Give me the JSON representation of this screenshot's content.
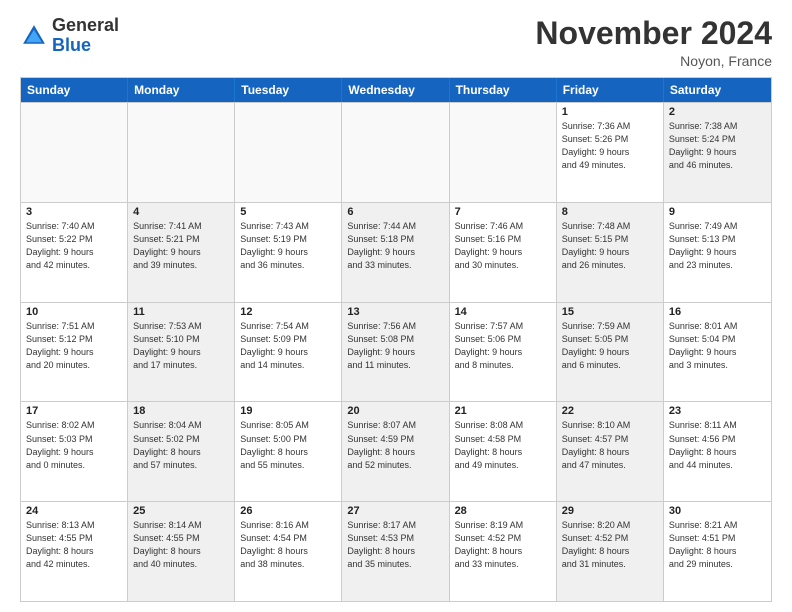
{
  "header": {
    "logo_general": "General",
    "logo_blue": "Blue",
    "month_title": "November 2024",
    "location": "Noyon, France"
  },
  "days_of_week": [
    "Sunday",
    "Monday",
    "Tuesday",
    "Wednesday",
    "Thursday",
    "Friday",
    "Saturday"
  ],
  "weeks": [
    [
      {
        "day": "",
        "info": "",
        "shaded": false,
        "empty": true
      },
      {
        "day": "",
        "info": "",
        "shaded": false,
        "empty": true
      },
      {
        "day": "",
        "info": "",
        "shaded": false,
        "empty": true
      },
      {
        "day": "",
        "info": "",
        "shaded": false,
        "empty": true
      },
      {
        "day": "",
        "info": "",
        "shaded": false,
        "empty": true
      },
      {
        "day": "1",
        "info": "Sunrise: 7:36 AM\nSunset: 5:26 PM\nDaylight: 9 hours\nand 49 minutes.",
        "shaded": false,
        "empty": false
      },
      {
        "day": "2",
        "info": "Sunrise: 7:38 AM\nSunset: 5:24 PM\nDaylight: 9 hours\nand 46 minutes.",
        "shaded": true,
        "empty": false
      }
    ],
    [
      {
        "day": "3",
        "info": "Sunrise: 7:40 AM\nSunset: 5:22 PM\nDaylight: 9 hours\nand 42 minutes.",
        "shaded": false,
        "empty": false
      },
      {
        "day": "4",
        "info": "Sunrise: 7:41 AM\nSunset: 5:21 PM\nDaylight: 9 hours\nand 39 minutes.",
        "shaded": true,
        "empty": false
      },
      {
        "day": "5",
        "info": "Sunrise: 7:43 AM\nSunset: 5:19 PM\nDaylight: 9 hours\nand 36 minutes.",
        "shaded": false,
        "empty": false
      },
      {
        "day": "6",
        "info": "Sunrise: 7:44 AM\nSunset: 5:18 PM\nDaylight: 9 hours\nand 33 minutes.",
        "shaded": true,
        "empty": false
      },
      {
        "day": "7",
        "info": "Sunrise: 7:46 AM\nSunset: 5:16 PM\nDaylight: 9 hours\nand 30 minutes.",
        "shaded": false,
        "empty": false
      },
      {
        "day": "8",
        "info": "Sunrise: 7:48 AM\nSunset: 5:15 PM\nDaylight: 9 hours\nand 26 minutes.",
        "shaded": true,
        "empty": false
      },
      {
        "day": "9",
        "info": "Sunrise: 7:49 AM\nSunset: 5:13 PM\nDaylight: 9 hours\nand 23 minutes.",
        "shaded": false,
        "empty": false
      }
    ],
    [
      {
        "day": "10",
        "info": "Sunrise: 7:51 AM\nSunset: 5:12 PM\nDaylight: 9 hours\nand 20 minutes.",
        "shaded": false,
        "empty": false
      },
      {
        "day": "11",
        "info": "Sunrise: 7:53 AM\nSunset: 5:10 PM\nDaylight: 9 hours\nand 17 minutes.",
        "shaded": true,
        "empty": false
      },
      {
        "day": "12",
        "info": "Sunrise: 7:54 AM\nSunset: 5:09 PM\nDaylight: 9 hours\nand 14 minutes.",
        "shaded": false,
        "empty": false
      },
      {
        "day": "13",
        "info": "Sunrise: 7:56 AM\nSunset: 5:08 PM\nDaylight: 9 hours\nand 11 minutes.",
        "shaded": true,
        "empty": false
      },
      {
        "day": "14",
        "info": "Sunrise: 7:57 AM\nSunset: 5:06 PM\nDaylight: 9 hours\nand 8 minutes.",
        "shaded": false,
        "empty": false
      },
      {
        "day": "15",
        "info": "Sunrise: 7:59 AM\nSunset: 5:05 PM\nDaylight: 9 hours\nand 6 minutes.",
        "shaded": true,
        "empty": false
      },
      {
        "day": "16",
        "info": "Sunrise: 8:01 AM\nSunset: 5:04 PM\nDaylight: 9 hours\nand 3 minutes.",
        "shaded": false,
        "empty": false
      }
    ],
    [
      {
        "day": "17",
        "info": "Sunrise: 8:02 AM\nSunset: 5:03 PM\nDaylight: 9 hours\nand 0 minutes.",
        "shaded": false,
        "empty": false
      },
      {
        "day": "18",
        "info": "Sunrise: 8:04 AM\nSunset: 5:02 PM\nDaylight: 8 hours\nand 57 minutes.",
        "shaded": true,
        "empty": false
      },
      {
        "day": "19",
        "info": "Sunrise: 8:05 AM\nSunset: 5:00 PM\nDaylight: 8 hours\nand 55 minutes.",
        "shaded": false,
        "empty": false
      },
      {
        "day": "20",
        "info": "Sunrise: 8:07 AM\nSunset: 4:59 PM\nDaylight: 8 hours\nand 52 minutes.",
        "shaded": true,
        "empty": false
      },
      {
        "day": "21",
        "info": "Sunrise: 8:08 AM\nSunset: 4:58 PM\nDaylight: 8 hours\nand 49 minutes.",
        "shaded": false,
        "empty": false
      },
      {
        "day": "22",
        "info": "Sunrise: 8:10 AM\nSunset: 4:57 PM\nDaylight: 8 hours\nand 47 minutes.",
        "shaded": true,
        "empty": false
      },
      {
        "day": "23",
        "info": "Sunrise: 8:11 AM\nSunset: 4:56 PM\nDaylight: 8 hours\nand 44 minutes.",
        "shaded": false,
        "empty": false
      }
    ],
    [
      {
        "day": "24",
        "info": "Sunrise: 8:13 AM\nSunset: 4:55 PM\nDaylight: 8 hours\nand 42 minutes.",
        "shaded": false,
        "empty": false
      },
      {
        "day": "25",
        "info": "Sunrise: 8:14 AM\nSunset: 4:55 PM\nDaylight: 8 hours\nand 40 minutes.",
        "shaded": true,
        "empty": false
      },
      {
        "day": "26",
        "info": "Sunrise: 8:16 AM\nSunset: 4:54 PM\nDaylight: 8 hours\nand 38 minutes.",
        "shaded": false,
        "empty": false
      },
      {
        "day": "27",
        "info": "Sunrise: 8:17 AM\nSunset: 4:53 PM\nDaylight: 8 hours\nand 35 minutes.",
        "shaded": true,
        "empty": false
      },
      {
        "day": "28",
        "info": "Sunrise: 8:19 AM\nSunset: 4:52 PM\nDaylight: 8 hours\nand 33 minutes.",
        "shaded": false,
        "empty": false
      },
      {
        "day": "29",
        "info": "Sunrise: 8:20 AM\nSunset: 4:52 PM\nDaylight: 8 hours\nand 31 minutes.",
        "shaded": true,
        "empty": false
      },
      {
        "day": "30",
        "info": "Sunrise: 8:21 AM\nSunset: 4:51 PM\nDaylight: 8 hours\nand 29 minutes.",
        "shaded": false,
        "empty": false
      }
    ]
  ]
}
